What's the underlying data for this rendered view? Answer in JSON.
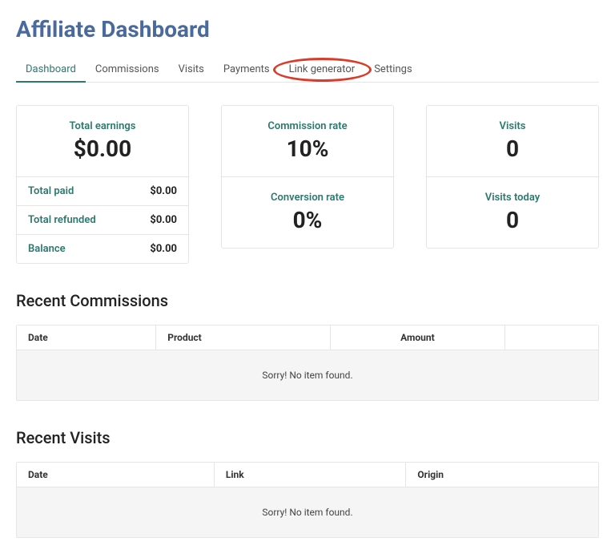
{
  "header": {
    "title": "Affiliate Dashboard"
  },
  "tabs": [
    "Dashboard",
    "Commissions",
    "Visits",
    "Payments",
    "Link generator",
    "Settings"
  ],
  "active_tab_index": 0,
  "cards": {
    "earnings": {
      "total_earnings_label": "Total earnings",
      "total_earnings_value": "$0.00",
      "rows": [
        {
          "label": "Total paid",
          "value": "$0.00"
        },
        {
          "label": "Total refunded",
          "value": "$0.00"
        },
        {
          "label": "Balance",
          "value": "$0.00"
        }
      ]
    },
    "rates": {
      "commission_label": "Commission rate",
      "commission_value": "10%",
      "conversion_label": "Conversion rate",
      "conversion_value": "0%"
    },
    "visits": {
      "visits_label": "Visits",
      "visits_value": "0",
      "today_label": "Visits today",
      "today_value": "0"
    }
  },
  "recent_commissions": {
    "title": "Recent Commissions",
    "columns": [
      "Date",
      "Product",
      "Amount",
      ""
    ],
    "empty_msg": "Sorry! No item found."
  },
  "recent_visits": {
    "title": "Recent Visits",
    "columns": [
      "Date",
      "Link",
      "Origin"
    ],
    "empty_msg": "Sorry! No item found."
  }
}
